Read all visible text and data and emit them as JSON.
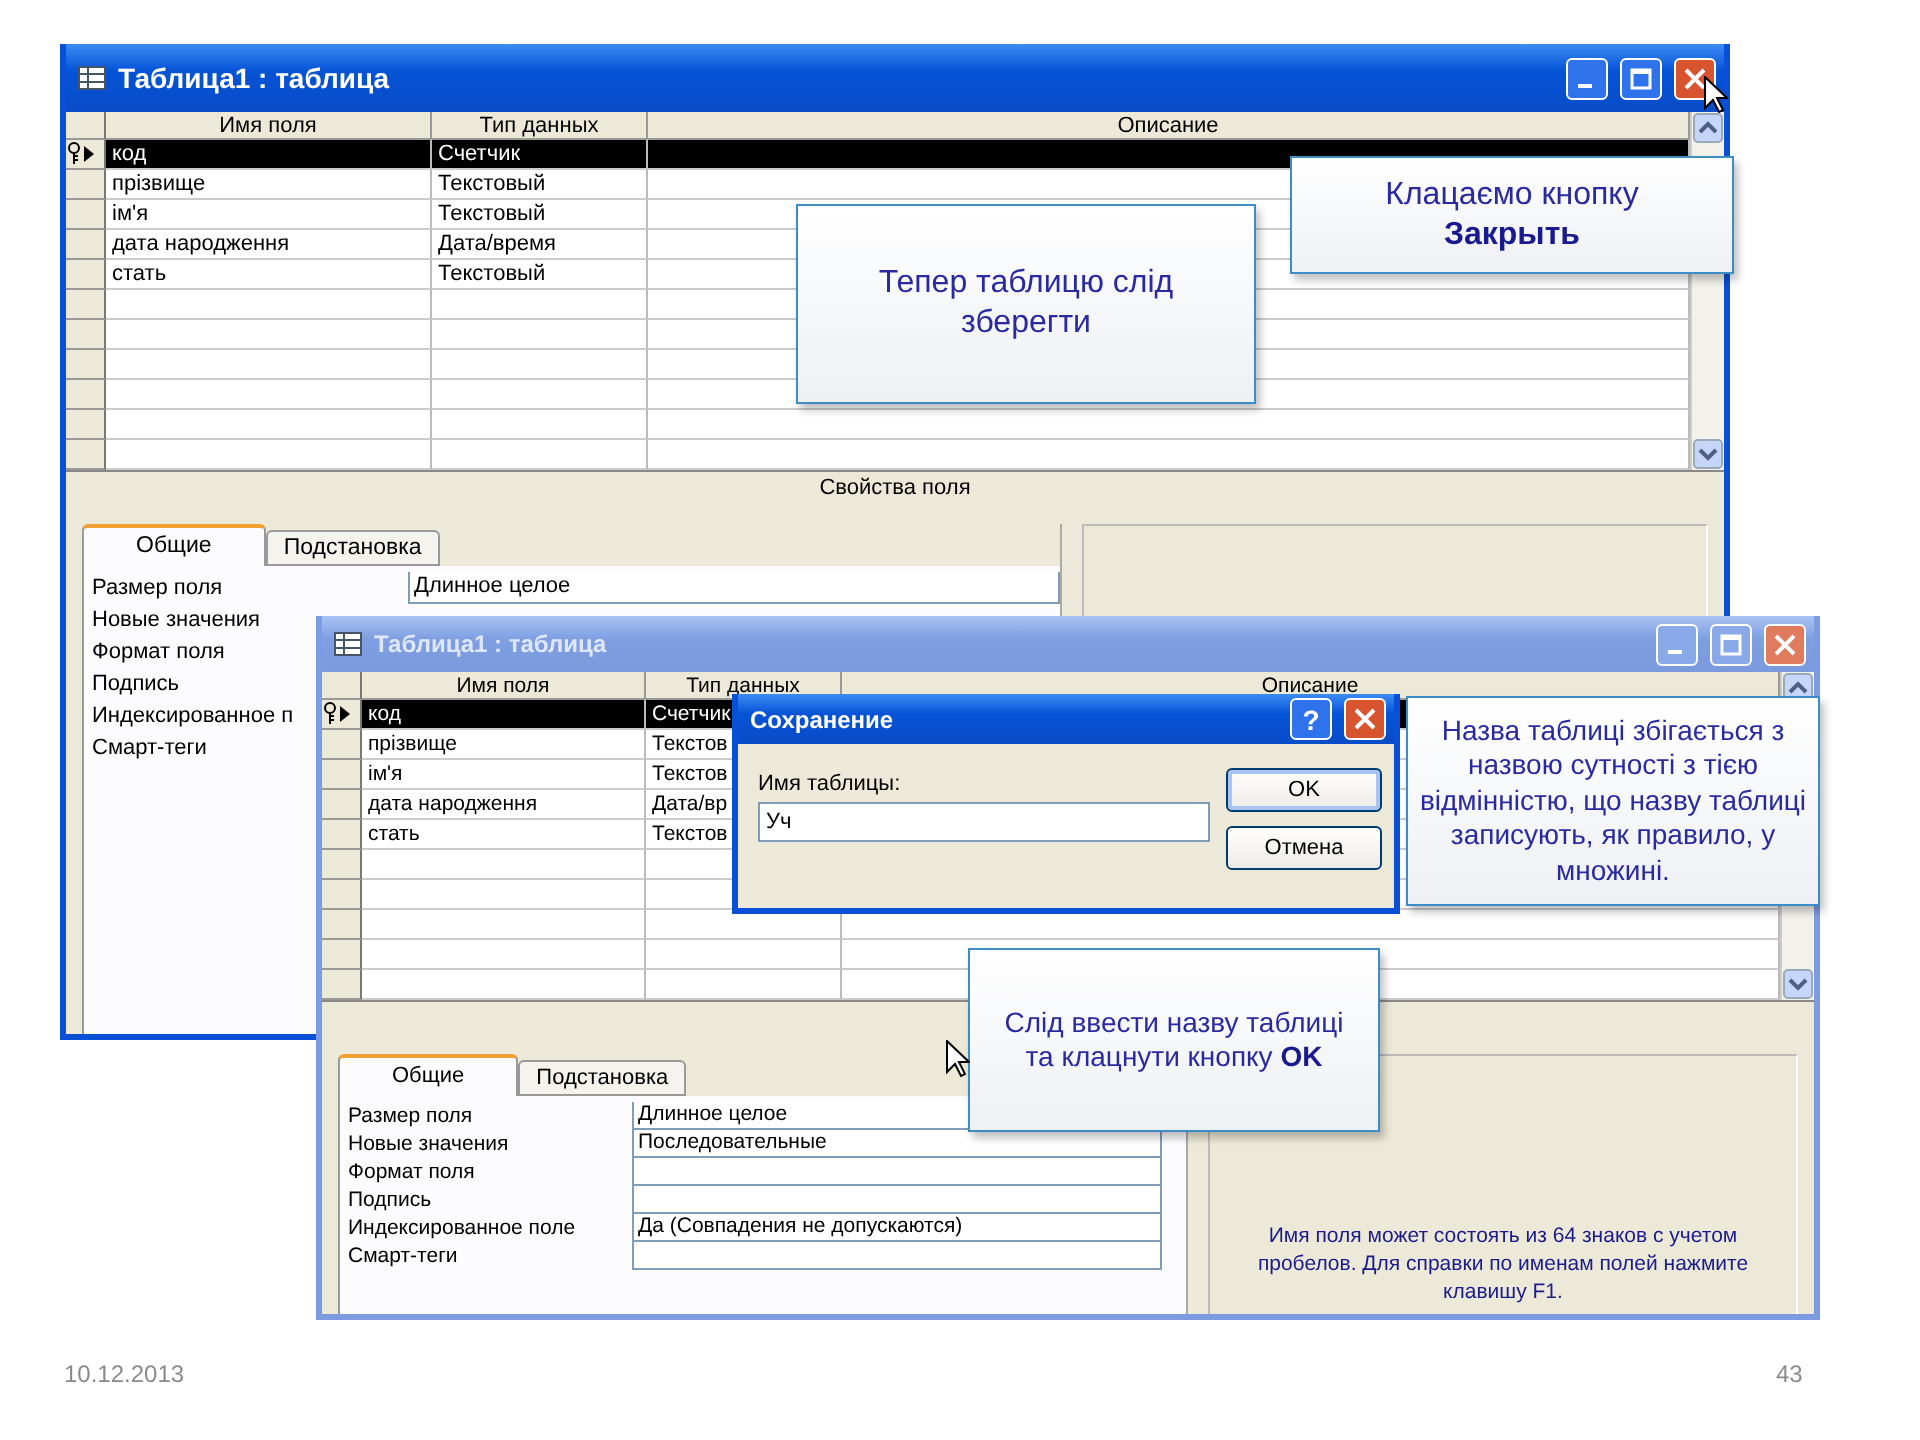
{
  "windows": [
    {
      "title": "Таблица1 : таблица",
      "active": true,
      "columns": [
        "Имя поля",
        "Тип данных",
        "Описание"
      ],
      "rows": [
        {
          "name": "код",
          "type": "Счетчик",
          "selected": true,
          "key": true
        },
        {
          "name": "прізвище",
          "type": "Текстовый",
          "selected": false,
          "key": false
        },
        {
          "name": "ім'я",
          "type": "Текстовый",
          "selected": false,
          "key": false
        },
        {
          "name": "дата народження",
          "type": "Дата/время",
          "selected": false,
          "key": false
        },
        {
          "name": "стать",
          "type": "Текстовый",
          "selected": false,
          "key": false
        }
      ],
      "properties_heading": "Свойства поля",
      "tabs": [
        {
          "label": "Общие",
          "selected": true
        },
        {
          "label": "Подстановка",
          "selected": false
        }
      ],
      "properties": [
        {
          "label": "Размер поля",
          "value": "Длинное целое"
        },
        {
          "label": "Новые значения"
        },
        {
          "label": "Формат поля"
        },
        {
          "label": "Подпись"
        },
        {
          "label": "Индексированное п"
        },
        {
          "label": "Смарт-теги"
        }
      ],
      "callouts": [
        {
          "text": "Тепер таблицю слід\nзберегти"
        },
        {
          "text": "Клацаємо кнопку\n**Закрыть**"
        }
      ]
    },
    {
      "title": "Таблица1 : таблица",
      "active": false,
      "columns": [
        "Имя поля",
        "Тип данных",
        "Описание"
      ],
      "rows": [
        {
          "name": "код",
          "type": "Счетчик",
          "selected": true,
          "key": true
        },
        {
          "name": "прізвище",
          "type": "Текстов",
          "selected": false,
          "key": false
        },
        {
          "name": "ім'я",
          "type": "Текстов",
          "selected": false,
          "key": false
        },
        {
          "name": "дата народження",
          "type": "Дата/вр",
          "selected": false,
          "key": false
        },
        {
          "name": "стать",
          "type": "Текстов",
          "selected": false,
          "key": false
        }
      ],
      "tabs": [
        {
          "label": "Общие",
          "selected": true
        },
        {
          "label": "Подстановка",
          "selected": false
        }
      ],
      "properties": [
        {
          "label": "Размер поля",
          "value": "Длинное целое"
        },
        {
          "label": "Новые значения",
          "value": "Последовательные"
        },
        {
          "label": "Формат поля"
        },
        {
          "label": "Подпись"
        },
        {
          "label": "Индексированное поле",
          "value": "Да (Совпадения не допускаются)"
        },
        {
          "label": "Смарт-теги"
        }
      ],
      "hint": "Имя поля может состоять из 64 знаков с учетом пробелов.  Для справки по именам полей нажмите клавишу F1.",
      "callouts": [
        {
          "text": "Назва таблиці збігається з назвою сутності з тією відмінністю, що назву таблиці записують, як правило, у множині."
        },
        {
          "text": "Слід ввести назву таблиці\nта клацнути кнопку **OK**"
        }
      ]
    }
  ],
  "dialog": {
    "title": "Сохранение",
    "help": "?",
    "label": "Имя таблицы:",
    "value": "Уч",
    "buttons": [
      {
        "label": "OK",
        "selected": true
      },
      {
        "label": "Отмена",
        "selected": false
      }
    ]
  },
  "slide": {
    "date": "10.12.2013",
    "page": "43"
  }
}
